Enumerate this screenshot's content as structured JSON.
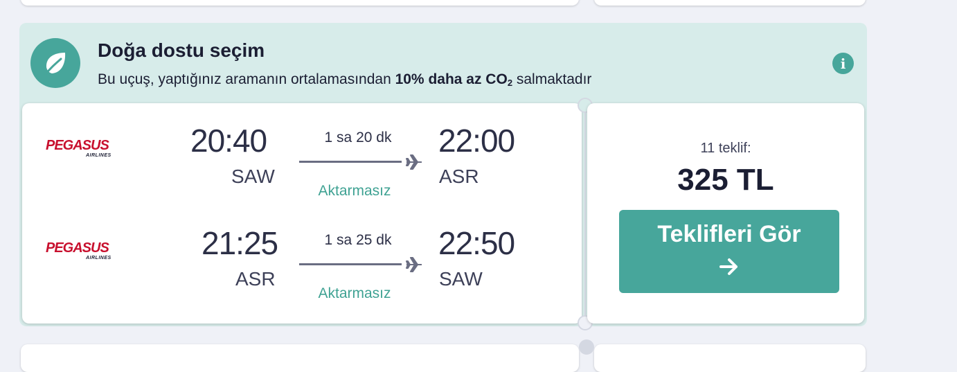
{
  "eco": {
    "title": "Doğa dostu seçim",
    "description_prefix": "Bu uçuş, yaptığınız aramanın ortalamasından ",
    "description_bold": "10% daha az CO",
    "description_sub": "2",
    "description_suffix": " salmaktadır",
    "icon": "leaf-icon",
    "info_icon": "info-icon",
    "accent": "#47a69b",
    "background": "#d7ecea"
  },
  "segments": [
    {
      "airline": "PEGASUS",
      "airline_sub": "AIRLINES",
      "depart_time": "20:40",
      "depart_airport": "SAW",
      "duration": "1 sa 20 dk",
      "stops": "Aktarmasız",
      "arrive_time": "22:00",
      "arrive_airport": "ASR"
    },
    {
      "airline": "PEGASUS",
      "airline_sub": "AIRLINES",
      "depart_time": "21:25",
      "depart_airport": "ASR",
      "duration": "1 sa 25 dk",
      "stops": "Aktarmasız",
      "arrive_time": "22:50",
      "arrive_airport": "SAW"
    }
  ],
  "price_panel": {
    "offers": "11 teklif:",
    "price": "325 TL",
    "cta_label": "Teklifleri Gör",
    "cta_icon": "arrow-right-icon"
  }
}
